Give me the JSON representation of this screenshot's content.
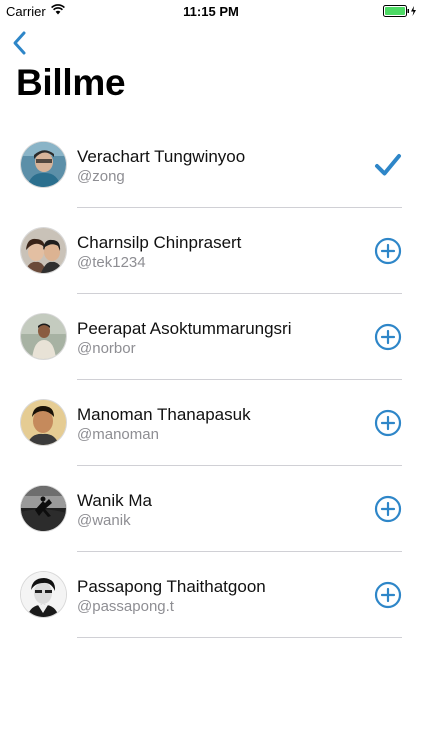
{
  "status_bar": {
    "carrier": "Carrier",
    "time": "11:15 PM"
  },
  "nav": {
    "back_icon": "chevron-left-icon",
    "title": "Billme"
  },
  "colors": {
    "accent": "#2e86c8",
    "battery": "#4cd964",
    "divider": "#d0d0d5",
    "handle": "#8e8e93"
  },
  "users": [
    {
      "name": "Verachart Tungwinyoo",
      "handle": "@zong",
      "selected": true,
      "action_icon": "checkmark-icon"
    },
    {
      "name": "Charnsilp Chinprasert",
      "handle": "@tek1234",
      "selected": false,
      "action_icon": "add-circle-icon"
    },
    {
      "name": "Peerapat Asoktummarungsri",
      "handle": "@norbor",
      "selected": false,
      "action_icon": "add-circle-icon"
    },
    {
      "name": "Manoman Thanapasuk",
      "handle": "@manoman",
      "selected": false,
      "action_icon": "add-circle-icon"
    },
    {
      "name": "Wanik Ma",
      "handle": "@wanik",
      "selected": false,
      "action_icon": "add-circle-icon"
    },
    {
      "name": "Passapong Thaithatgoon",
      "handle": "@passapong.t",
      "selected": false,
      "action_icon": "add-circle-icon"
    }
  ]
}
